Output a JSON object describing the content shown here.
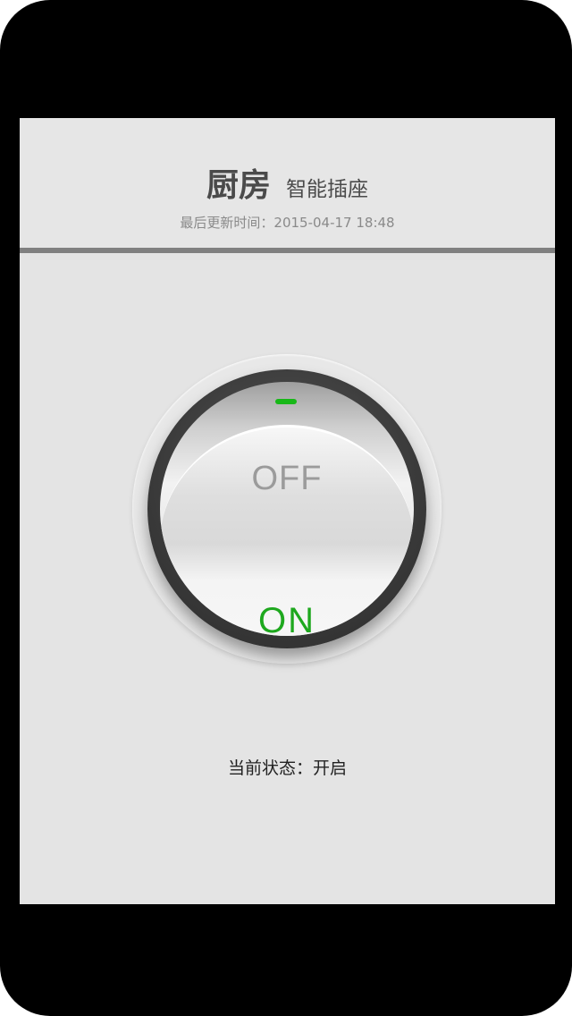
{
  "header": {
    "room_name": "厨房",
    "device_type": "智能插座",
    "last_updated_label": "最后更新时间：",
    "last_updated_value": "2015-04-17 18:48"
  },
  "switch": {
    "off_label": "OFF",
    "on_label": "ON",
    "is_on": true,
    "indicator_color": "#18b818",
    "on_color": "#1ea81e"
  },
  "status": {
    "label": "当前状态：",
    "value": "开启"
  }
}
